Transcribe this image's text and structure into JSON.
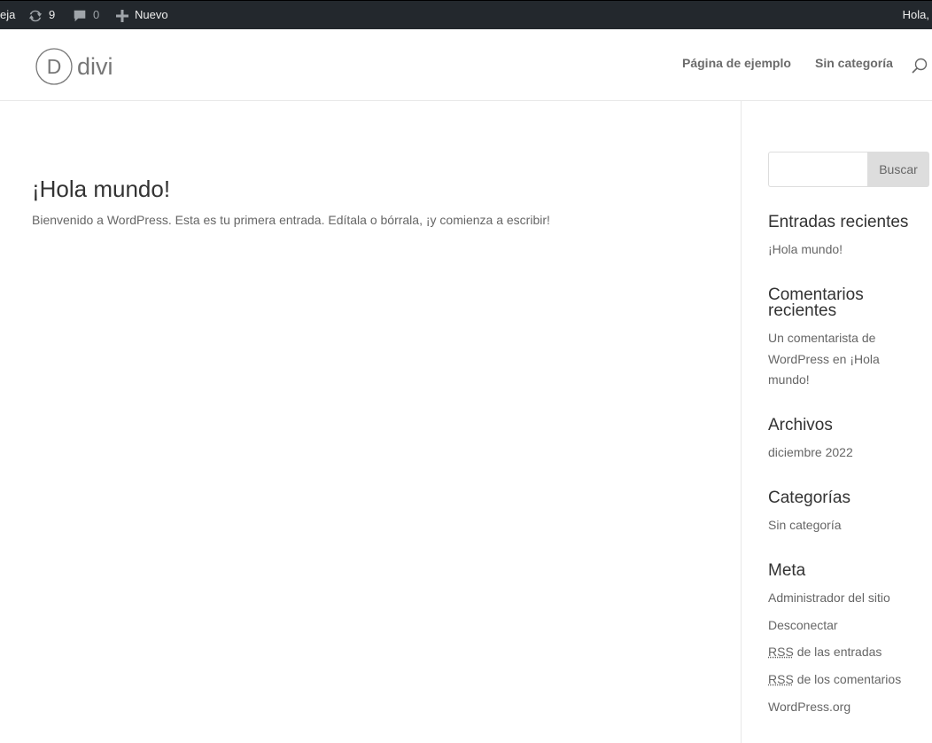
{
  "admin_bar": {
    "site_fragment": "eja",
    "updates_count": "9",
    "comments_count": "0",
    "new_label": "Nuevo",
    "greeting": "Hola,"
  },
  "header": {
    "logo_text": "divi",
    "logo_letter": "D",
    "nav": [
      "Página de ejemplo",
      "Sin categoría"
    ]
  },
  "post": {
    "title": "¡Hola mundo!",
    "excerpt": "Bienvenido a WordPress. Esta es tu primera entrada. Edítala o bórrala, ¡y comienza a escribir!"
  },
  "sidebar": {
    "search": {
      "placeholder": "",
      "button_label": "Buscar"
    },
    "recent_posts": {
      "title": "Entradas recientes",
      "items": [
        "¡Hola mundo!"
      ]
    },
    "recent_comments": {
      "title_line1": "Comentarios",
      "title_line2": "recientes",
      "line1": "Un comentarista de",
      "line2": "WordPress en ¡Hola",
      "line3": "mundo!"
    },
    "archives": {
      "title": "Archivos",
      "items": [
        "diciembre 2022"
      ]
    },
    "categories": {
      "title": "Categorías",
      "items": [
        "Sin categoría"
      ]
    },
    "meta": {
      "title": "Meta",
      "admin": "Administrador del sitio",
      "logout": "Desconectar",
      "rss_abbr": "RSS",
      "rss_entries": "de las entradas",
      "rss_comments": "de los comentarios",
      "wporg": "WordPress.org"
    }
  }
}
